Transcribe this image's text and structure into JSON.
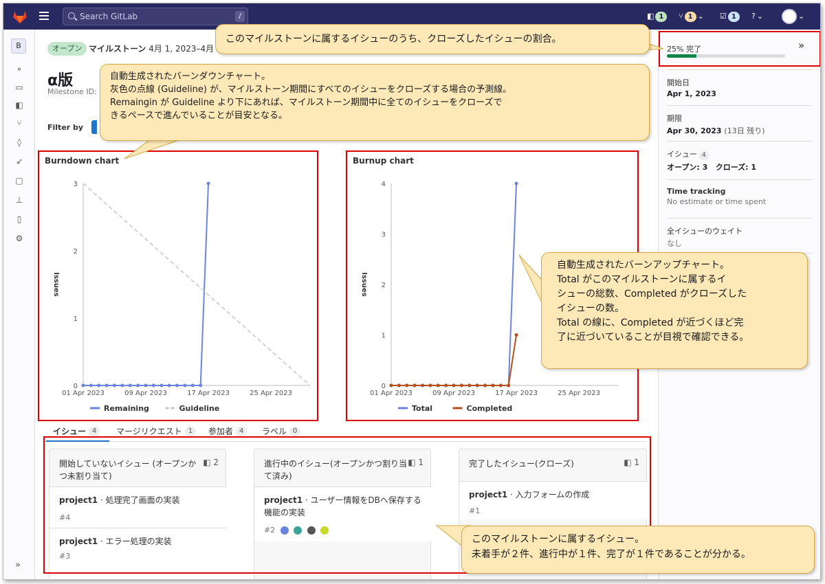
{
  "topbar": {
    "search_placeholder": "Search GitLab",
    "search_shortcut": "/",
    "issues_badge": "1",
    "mr_badge": "1",
    "todos_badge": "1"
  },
  "sidebar": {
    "project_initial": "B",
    "collapse_glyph": "»"
  },
  "milestone": {
    "status": "オープン",
    "type_label": "マイルストーン",
    "date_range": "4月 1, 2023–4月 3",
    "title": "α版",
    "id_label": "Milestone ID:",
    "filter_label": "Filter by"
  },
  "burndown": {
    "title": "Burndown chart",
    "ylabel": "Issues",
    "legend": [
      "Remaining",
      "Guideline"
    ]
  },
  "burnup": {
    "title": "Burnup chart",
    "ylabel": "Issues",
    "legend": [
      "Total",
      "Completed"
    ]
  },
  "chart_data": [
    {
      "type": "line",
      "title": "Burndown chart",
      "xlabel": "",
      "ylabel": "Issues",
      "x_ticks": [
        "01 Apr 2023",
        "09 Apr 2023",
        "17 Apr 2023",
        "25 Apr 2023"
      ],
      "x_range": [
        1,
        30
      ],
      "ylim": [
        0,
        3
      ],
      "y_ticks": [
        0,
        1,
        2,
        3
      ],
      "legend_position": "bottom",
      "series": [
        {
          "name": "Remaining",
          "color": "#6b84e0",
          "style": "solid",
          "x": [
            1,
            2,
            3,
            4,
            5,
            6,
            7,
            8,
            9,
            10,
            11,
            12,
            13,
            14,
            15,
            16,
            17
          ],
          "y": [
            0,
            0,
            0,
            0,
            0,
            0,
            0,
            0,
            0,
            0,
            0,
            0,
            0,
            0,
            0,
            0,
            3
          ]
        },
        {
          "name": "Guideline",
          "color": "#c6c6cc",
          "style": "dashed",
          "x": [
            1,
            30
          ],
          "y": [
            3,
            0
          ]
        }
      ]
    },
    {
      "type": "line",
      "title": "Burnup chart",
      "xlabel": "",
      "ylabel": "Issues",
      "x_ticks": [
        "01 Apr 2023",
        "09 Apr 2023",
        "17 Apr 2023",
        "25 Apr 2023"
      ],
      "x_range": [
        1,
        30
      ],
      "ylim": [
        0,
        4
      ],
      "y_ticks": [
        0,
        1,
        2,
        3,
        4
      ],
      "legend_position": "bottom",
      "series": [
        {
          "name": "Total",
          "color": "#6b84e0",
          "style": "solid",
          "x": [
            1,
            2,
            3,
            4,
            5,
            6,
            7,
            8,
            9,
            10,
            11,
            12,
            13,
            14,
            15,
            16,
            17
          ],
          "y": [
            0,
            0,
            0,
            0,
            0,
            0,
            0,
            0,
            0,
            0,
            0,
            0,
            0,
            0,
            0,
            0,
            4
          ]
        },
        {
          "name": "Completed",
          "color": "#b5501d",
          "style": "solid",
          "x": [
            1,
            2,
            3,
            4,
            5,
            6,
            7,
            8,
            9,
            10,
            11,
            12,
            13,
            14,
            15,
            16,
            17
          ],
          "y": [
            0,
            0,
            0,
            0,
            0,
            0,
            0,
            0,
            0,
            0,
            0,
            0,
            0,
            0,
            0,
            0,
            1
          ]
        }
      ]
    }
  ],
  "tabs": [
    {
      "label": "イシュー",
      "count": "4"
    },
    {
      "label": "マージリクエスト",
      "count": "1"
    },
    {
      "label": "参加者",
      "count": "4"
    },
    {
      "label": "ラベル",
      "count": "0"
    }
  ],
  "board": [
    {
      "header": "開始していないイシュー (オープンかつ未割り当て)",
      "count": "2",
      "cards": [
        {
          "project": "project1",
          "title": "処理完了画面の実装",
          "ref": "#4"
        },
        {
          "project": "project1",
          "title": "エラー処理の実装",
          "ref": "#3"
        }
      ]
    },
    {
      "header": "進行中のイシュー(オープンかつ割り当て済み)",
      "count": "1",
      "cards": [
        {
          "project": "project1",
          "title": "ユーザー情報をDBへ保存する機能の実装",
          "ref": "#2"
        }
      ]
    },
    {
      "header": "完了したイシュー(クローズ)",
      "count": "1",
      "cards": [
        {
          "project": "project1",
          "title": "入力フォームの作成",
          "ref": "#1"
        }
      ]
    }
  ],
  "right": {
    "progress_label": "25% 完了",
    "progress": 0.25,
    "expand_glyph": "»",
    "start_label": "開始日",
    "start_value": "Apr 1, 2023",
    "due_label": "期限",
    "due_value": "Apr 30, 2023",
    "due_remaining": "(13日 残り)",
    "issues_label": "イシュー",
    "issues_count": "4",
    "issues_open": "オープン: 3",
    "issues_closed": "クローズ: 1",
    "time_label": "Time tracking",
    "time_value": "No estimate or time spent",
    "weight_label": "全イシューのウェイト",
    "weight_value": "なし"
  },
  "callouts": {
    "progress": "このマイルストーンに属するイシューのうち、クローズしたイシューの割合。",
    "burndown": [
      "自動生成されたバーンダウンチャート。",
      "灰色の点線 (Guideline) が、マイルストーン期間にすべてのイシューをクローズする場合の予測線。",
      "Remaingin が Guideline より下にあれば、マイルストーン期間中に全てのイシューをクローズで",
      "きるペースで進んでいることが目安となる。"
    ],
    "burnup": [
      "自動生成されたバーンアップチャート。",
      "Total がこのマイルストーンに属するイ",
      "シューの総数、Completed がクローズした",
      "イシューの数。",
      "Total の線に、Completed が近づくほど完",
      "了に近づいていることが目視で確認できる。"
    ],
    "board": [
      "このマイルストーンに属するイシュー。",
      "未着手が２件、進行中が１件、完了が１件であることが分かる。"
    ]
  },
  "colors": {
    "topbar": "#292961",
    "accent": "#1f75cb",
    "highlight_box": "#e00000",
    "callout_bg": "#fde9b8"
  }
}
